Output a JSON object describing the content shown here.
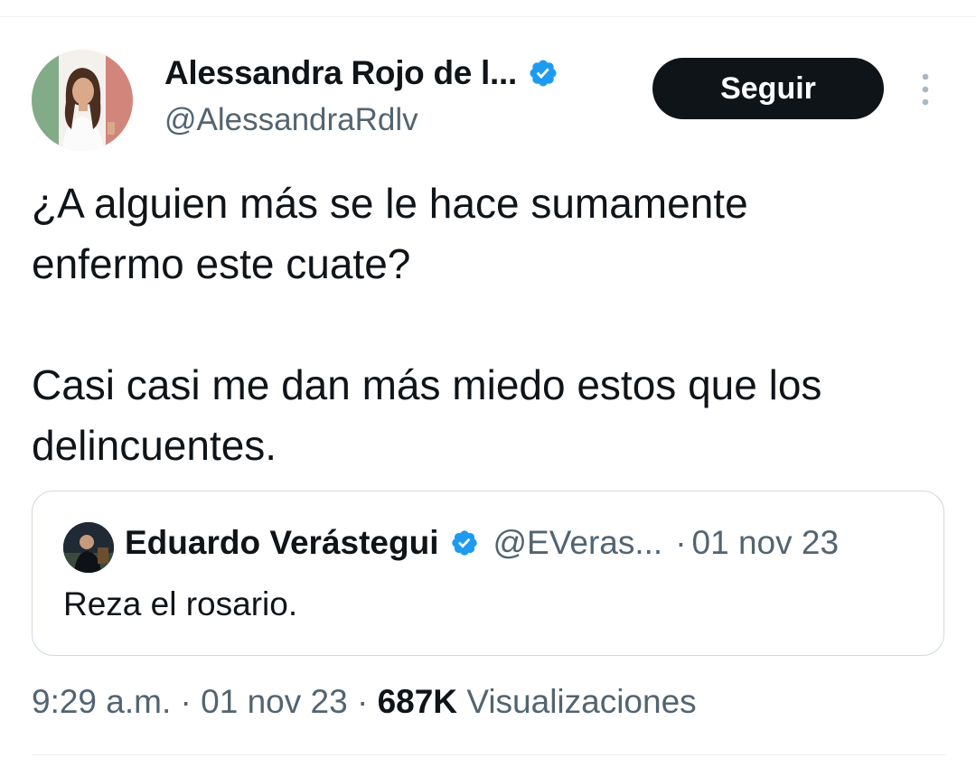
{
  "author": {
    "display_name": "Alessandra Rojo de l...",
    "handle": "@AlessandraRdlv",
    "verified": true,
    "avatar_icon": "profile-photo"
  },
  "follow_button": {
    "label": "Seguir"
  },
  "more_icon": "vertical-ellipsis-icon",
  "tweet": {
    "paragraphs": [
      "¿A alguien más se le hace sumamente",
      "enfermo este cuate?",
      "Casi casi me dan más miedo estos que los",
      "delincuentes."
    ]
  },
  "quoted_tweet": {
    "display_name": "Eduardo Verástegui",
    "handle": "@EVeras...",
    "separator": "·",
    "date": "01 nov 23",
    "text": "Reza el rosario.",
    "verified": true
  },
  "meta": {
    "time": "9:29 a.m.",
    "sep1": "·",
    "date": "01 nov 23",
    "sep2": "·",
    "views_count": "687K",
    "views_label": "Visualizaciones"
  },
  "colors": {
    "text_primary": "#0f1419",
    "text_secondary": "#536471",
    "verified_blue": "#1d9bf0",
    "border": "#cfd9de"
  }
}
